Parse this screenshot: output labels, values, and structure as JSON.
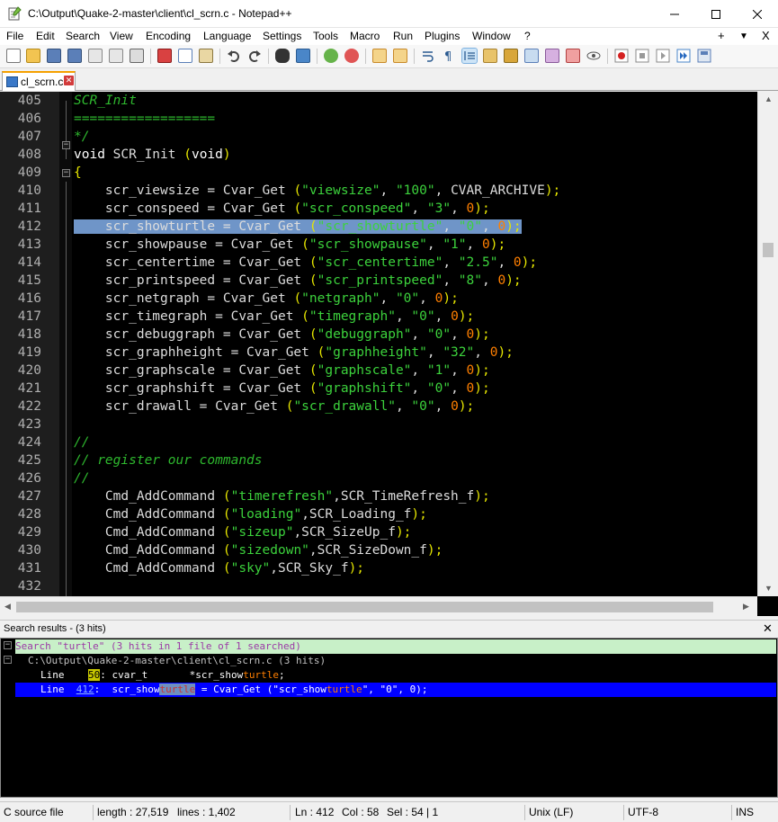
{
  "window": {
    "title": "C:\\Output\\Quake-2-master\\client\\cl_scrn.c - Notepad++",
    "minimize": "—",
    "maximize": "☐",
    "close": "✕"
  },
  "menu": {
    "items": [
      "File",
      "Edit",
      "Search",
      "View",
      "Encoding",
      "Language",
      "Settings",
      "Tools",
      "Macro",
      "Run",
      "Plugins",
      "Window",
      "?"
    ],
    "right": [
      "+",
      "▼",
      "X"
    ]
  },
  "tab": {
    "label": "cl_scrn.c",
    "close": "✕"
  },
  "editor": {
    "first_line": 405,
    "lines": [
      {
        "n": "405",
        "tokens": [
          {
            "t": "SCR_Init",
            "c": "cmt"
          }
        ]
      },
      {
        "n": "406",
        "tokens": [
          {
            "t": "==================",
            "c": "cmt"
          }
        ]
      },
      {
        "n": "407",
        "tokens": [
          {
            "t": "*/",
            "c": "cmt"
          }
        ]
      },
      {
        "n": "408",
        "tokens": [
          {
            "t": "void",
            "c": "kw"
          },
          {
            "t": " SCR_Init ",
            "c": "fn"
          },
          {
            "t": "(",
            "c": "par"
          },
          {
            "t": "void",
            "c": "kw"
          },
          {
            "t": ")",
            "c": "par"
          }
        ]
      },
      {
        "n": "409",
        "tokens": [
          {
            "t": "{",
            "c": "par"
          }
        ]
      },
      {
        "n": "410",
        "tokens": [
          {
            "t": "    scr_viewsize = Cvar_Get ",
            "c": "fn"
          },
          {
            "t": "(",
            "c": "par"
          },
          {
            "t": "\"viewsize\"",
            "c": "str"
          },
          {
            "t": ", ",
            "c": "fn"
          },
          {
            "t": "\"100\"",
            "c": "str"
          },
          {
            "t": ", CVAR_ARCHIVE",
            "c": "fn"
          },
          {
            "t": ");",
            "c": "par"
          }
        ]
      },
      {
        "n": "411",
        "tokens": [
          {
            "t": "    scr_conspeed = Cvar_Get ",
            "c": "fn"
          },
          {
            "t": "(",
            "c": "par"
          },
          {
            "t": "\"scr_conspeed\"",
            "c": "str"
          },
          {
            "t": ", ",
            "c": "fn"
          },
          {
            "t": "\"3\"",
            "c": "str"
          },
          {
            "t": ", ",
            "c": "fn"
          },
          {
            "t": "0",
            "c": "num"
          },
          {
            "t": ");",
            "c": "par"
          }
        ]
      },
      {
        "n": "412",
        "sel": true,
        "tokens": [
          {
            "t": "    scr_showturtle = Cvar_Get ",
            "c": "fn"
          },
          {
            "t": "(",
            "c": "par"
          },
          {
            "t": "\"scr_showturtle\"",
            "c": "str"
          },
          {
            "t": ", ",
            "c": "fn"
          },
          {
            "t": "\"0\"",
            "c": "str"
          },
          {
            "t": ", ",
            "c": "fn"
          },
          {
            "t": "0",
            "c": "num"
          },
          {
            "t": ");",
            "c": "par"
          }
        ]
      },
      {
        "n": "413",
        "tokens": [
          {
            "t": "    scr_showpause = Cvar_Get ",
            "c": "fn"
          },
          {
            "t": "(",
            "c": "par"
          },
          {
            "t": "\"scr_showpause\"",
            "c": "str"
          },
          {
            "t": ", ",
            "c": "fn"
          },
          {
            "t": "\"1\"",
            "c": "str"
          },
          {
            "t": ", ",
            "c": "fn"
          },
          {
            "t": "0",
            "c": "num"
          },
          {
            "t": ");",
            "c": "par"
          }
        ]
      },
      {
        "n": "414",
        "tokens": [
          {
            "t": "    scr_centertime = Cvar_Get ",
            "c": "fn"
          },
          {
            "t": "(",
            "c": "par"
          },
          {
            "t": "\"scr_centertime\"",
            "c": "str"
          },
          {
            "t": ", ",
            "c": "fn"
          },
          {
            "t": "\"2.5\"",
            "c": "str"
          },
          {
            "t": ", ",
            "c": "fn"
          },
          {
            "t": "0",
            "c": "num"
          },
          {
            "t": ");",
            "c": "par"
          }
        ]
      },
      {
        "n": "415",
        "tokens": [
          {
            "t": "    scr_printspeed = Cvar_Get ",
            "c": "fn"
          },
          {
            "t": "(",
            "c": "par"
          },
          {
            "t": "\"scr_printspeed\"",
            "c": "str"
          },
          {
            "t": ", ",
            "c": "fn"
          },
          {
            "t": "\"8\"",
            "c": "str"
          },
          {
            "t": ", ",
            "c": "fn"
          },
          {
            "t": "0",
            "c": "num"
          },
          {
            "t": ");",
            "c": "par"
          }
        ]
      },
      {
        "n": "416",
        "tokens": [
          {
            "t": "    scr_netgraph = Cvar_Get ",
            "c": "fn"
          },
          {
            "t": "(",
            "c": "par"
          },
          {
            "t": "\"netgraph\"",
            "c": "str"
          },
          {
            "t": ", ",
            "c": "fn"
          },
          {
            "t": "\"0\"",
            "c": "str"
          },
          {
            "t": ", ",
            "c": "fn"
          },
          {
            "t": "0",
            "c": "num"
          },
          {
            "t": ");",
            "c": "par"
          }
        ]
      },
      {
        "n": "417",
        "tokens": [
          {
            "t": "    scr_timegraph = Cvar_Get ",
            "c": "fn"
          },
          {
            "t": "(",
            "c": "par"
          },
          {
            "t": "\"timegraph\"",
            "c": "str"
          },
          {
            "t": ", ",
            "c": "fn"
          },
          {
            "t": "\"0\"",
            "c": "str"
          },
          {
            "t": ", ",
            "c": "fn"
          },
          {
            "t": "0",
            "c": "num"
          },
          {
            "t": ");",
            "c": "par"
          }
        ]
      },
      {
        "n": "418",
        "tokens": [
          {
            "t": "    scr_debuggraph = Cvar_Get ",
            "c": "fn"
          },
          {
            "t": "(",
            "c": "par"
          },
          {
            "t": "\"debuggraph\"",
            "c": "str"
          },
          {
            "t": ", ",
            "c": "fn"
          },
          {
            "t": "\"0\"",
            "c": "str"
          },
          {
            "t": ", ",
            "c": "fn"
          },
          {
            "t": "0",
            "c": "num"
          },
          {
            "t": ");",
            "c": "par"
          }
        ]
      },
      {
        "n": "419",
        "tokens": [
          {
            "t": "    scr_graphheight = Cvar_Get ",
            "c": "fn"
          },
          {
            "t": "(",
            "c": "par"
          },
          {
            "t": "\"graphheight\"",
            "c": "str"
          },
          {
            "t": ", ",
            "c": "fn"
          },
          {
            "t": "\"32\"",
            "c": "str"
          },
          {
            "t": ", ",
            "c": "fn"
          },
          {
            "t": "0",
            "c": "num"
          },
          {
            "t": ");",
            "c": "par"
          }
        ]
      },
      {
        "n": "420",
        "tokens": [
          {
            "t": "    scr_graphscale = Cvar_Get ",
            "c": "fn"
          },
          {
            "t": "(",
            "c": "par"
          },
          {
            "t": "\"graphscale\"",
            "c": "str"
          },
          {
            "t": ", ",
            "c": "fn"
          },
          {
            "t": "\"1\"",
            "c": "str"
          },
          {
            "t": ", ",
            "c": "fn"
          },
          {
            "t": "0",
            "c": "num"
          },
          {
            "t": ");",
            "c": "par"
          }
        ]
      },
      {
        "n": "421",
        "tokens": [
          {
            "t": "    scr_graphshift = Cvar_Get ",
            "c": "fn"
          },
          {
            "t": "(",
            "c": "par"
          },
          {
            "t": "\"graphshift\"",
            "c": "str"
          },
          {
            "t": ", ",
            "c": "fn"
          },
          {
            "t": "\"0\"",
            "c": "str"
          },
          {
            "t": ", ",
            "c": "fn"
          },
          {
            "t": "0",
            "c": "num"
          },
          {
            "t": ");",
            "c": "par"
          }
        ]
      },
      {
        "n": "422",
        "tokens": [
          {
            "t": "    scr_drawall = Cvar_Get ",
            "c": "fn"
          },
          {
            "t": "(",
            "c": "par"
          },
          {
            "t": "\"scr_drawall\"",
            "c": "str"
          },
          {
            "t": ", ",
            "c": "fn"
          },
          {
            "t": "\"0\"",
            "c": "str"
          },
          {
            "t": ", ",
            "c": "fn"
          },
          {
            "t": "0",
            "c": "num"
          },
          {
            "t": ");",
            "c": "par"
          }
        ]
      },
      {
        "n": "423",
        "tokens": []
      },
      {
        "n": "424",
        "tokens": [
          {
            "t": "//",
            "c": "cmt"
          }
        ]
      },
      {
        "n": "425",
        "tokens": [
          {
            "t": "// register our commands",
            "c": "cmt"
          }
        ]
      },
      {
        "n": "426",
        "tokens": [
          {
            "t": "//",
            "c": "cmt"
          }
        ]
      },
      {
        "n": "427",
        "tokens": [
          {
            "t": "    Cmd_AddCommand ",
            "c": "fn"
          },
          {
            "t": "(",
            "c": "par"
          },
          {
            "t": "\"timerefresh\"",
            "c": "str"
          },
          {
            "t": ",SCR_TimeRefresh_f",
            "c": "fn"
          },
          {
            "t": ");",
            "c": "par"
          }
        ]
      },
      {
        "n": "428",
        "tokens": [
          {
            "t": "    Cmd_AddCommand ",
            "c": "fn"
          },
          {
            "t": "(",
            "c": "par"
          },
          {
            "t": "\"loading\"",
            "c": "str"
          },
          {
            "t": ",SCR_Loading_f",
            "c": "fn"
          },
          {
            "t": ");",
            "c": "par"
          }
        ]
      },
      {
        "n": "429",
        "tokens": [
          {
            "t": "    Cmd_AddCommand ",
            "c": "fn"
          },
          {
            "t": "(",
            "c": "par"
          },
          {
            "t": "\"sizeup\"",
            "c": "str"
          },
          {
            "t": ",SCR_SizeUp_f",
            "c": "fn"
          },
          {
            "t": ");",
            "c": "par"
          }
        ]
      },
      {
        "n": "430",
        "tokens": [
          {
            "t": "    Cmd_AddCommand ",
            "c": "fn"
          },
          {
            "t": "(",
            "c": "par"
          },
          {
            "t": "\"sizedown\"",
            "c": "str"
          },
          {
            "t": ",SCR_SizeDown_f",
            "c": "fn"
          },
          {
            "t": ");",
            "c": "par"
          }
        ]
      },
      {
        "n": "431",
        "tokens": [
          {
            "t": "    Cmd_AddCommand ",
            "c": "fn"
          },
          {
            "t": "(",
            "c": "par"
          },
          {
            "t": "\"sky\"",
            "c": "str"
          },
          {
            "t": ",SCR_Sky_f",
            "c": "fn"
          },
          {
            "t": ");",
            "c": "par"
          }
        ]
      },
      {
        "n": "432",
        "tokens": []
      }
    ]
  },
  "search": {
    "panel_title": "Search results - (3 hits)",
    "close": "✕",
    "header": "Search \"turtle\" (3 hits in 1 file of 1 searched)",
    "file_line": "C:\\Output\\Quake-2-master\\client\\cl_scrn.c (3 hits)",
    "hits": [
      {
        "prefix": "Line ",
        "num": "50",
        "before": ": cvar_t       *scr_show",
        "match": "turtle",
        "after": ";",
        "after2": ""
      },
      {
        "prefix": "Line ",
        "num": "412",
        "before": ":  scr_show",
        "match": "turtle",
        "after": " = Cvar_Get (\"scr_show",
        "after2": "turtle",
        "tail": "\", \"0\", 0);"
      }
    ]
  },
  "status": {
    "language": "C source file",
    "length": "length : 27,519",
    "lines": "lines : 1,402",
    "ln": "Ln : 412",
    "col": "Col : 58",
    "sel": "Sel : 54 | 1",
    "eol": "Unix (LF)",
    "encoding": "UTF-8",
    "mode": "INS"
  },
  "colors": {
    "editor_bg": "#000000",
    "selection": "#6f95c8",
    "string": "#3cd23c",
    "number": "#ff7f00",
    "comment": "#2eb82e",
    "paren": "#e6e600",
    "search_header_bg": "#c8f0c8",
    "current_hit_bg": "#0000ff",
    "tab_accent": "#f5a000"
  }
}
